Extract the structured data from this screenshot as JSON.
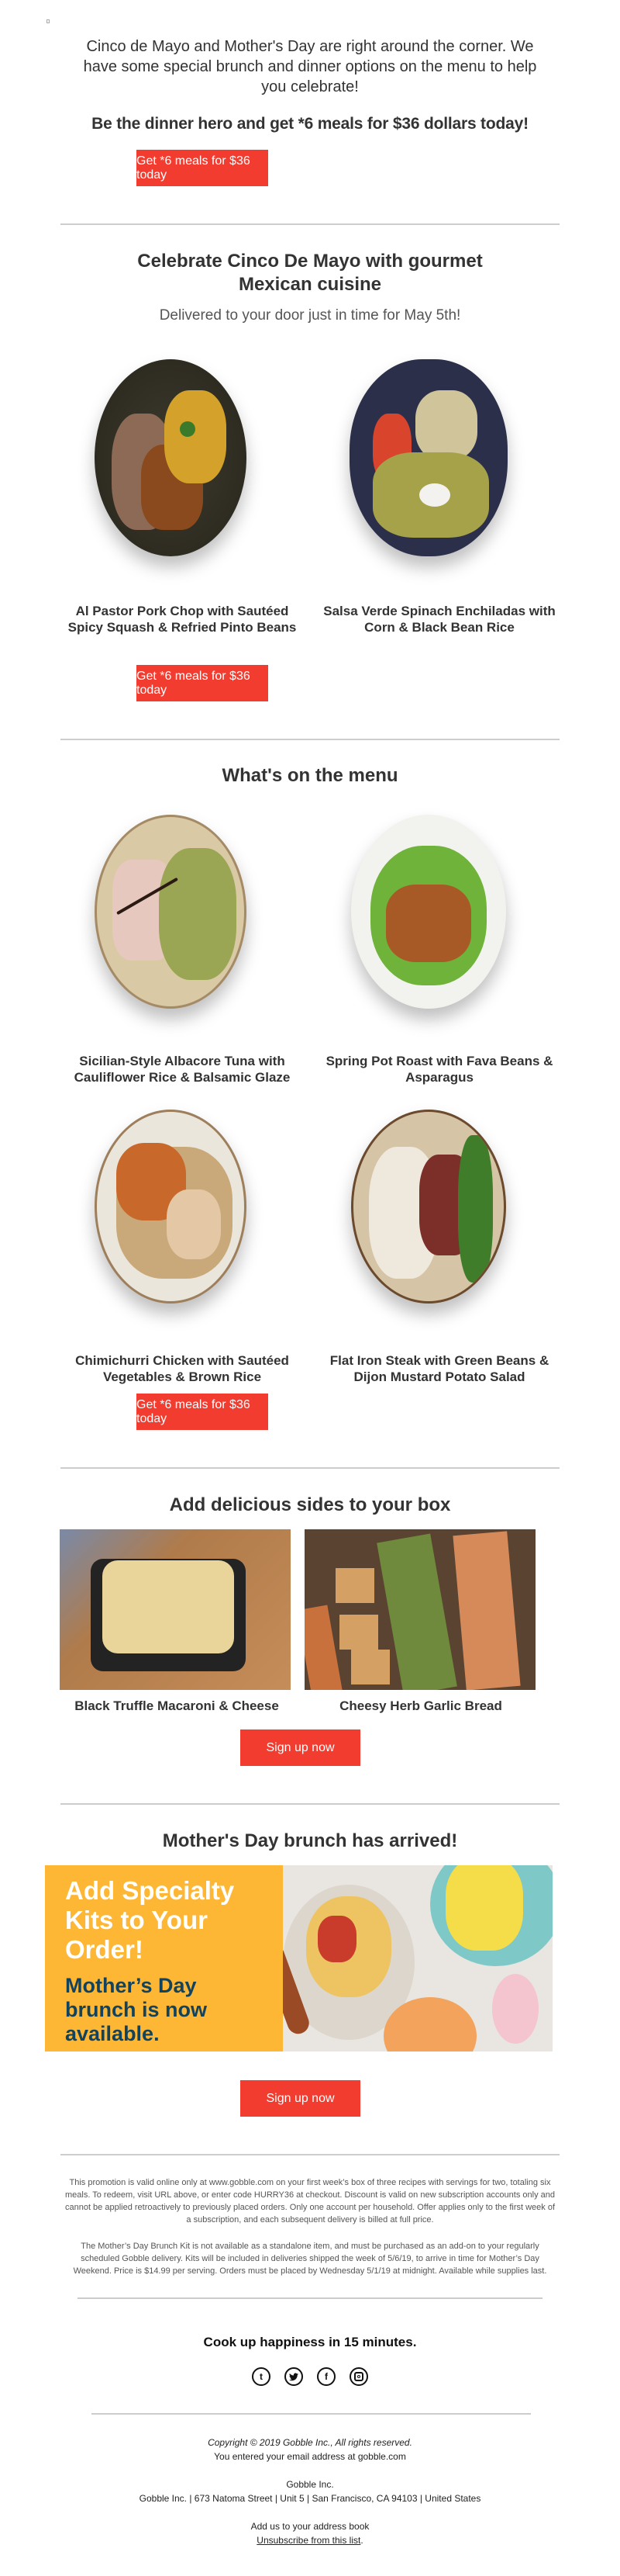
{
  "intro": {
    "text": "Cinco de Mayo and Mother's Day are right around the corner. We have some special brunch and dinner options on the menu to help you celebrate!",
    "headline": "Be the dinner hero and get *6 meals for $36 dollars today!",
    "cta_label": "Get *6 meals for $36 today"
  },
  "cinco": {
    "title": "Celebrate Cinco De Mayo with gourmet Mexican cuisine",
    "subtitle": "Delivered to your door just in time for May 5th!",
    "dishes": [
      {
        "name": "Al Pastor Pork Chop with Sautéed Spicy Squash & Refried Pinto Beans"
      },
      {
        "name": "Salsa Verde Spinach Enchiladas with Corn & Black Bean Rice"
      }
    ],
    "cta_label": "Get *6 meals for $36 today"
  },
  "menu": {
    "title": "What's on the menu",
    "dishes": [
      {
        "name": "Sicilian-Style Albacore Tuna with Cauliflower Rice & Balsamic Glaze"
      },
      {
        "name": "Spring Pot Roast with Fava Beans & Asparagus"
      },
      {
        "name": "Chimichurri Chicken with Sautéed Vegetables & Brown Rice"
      },
      {
        "name": "Flat Iron Steak with Green Beans & Dijon Mustard Potato Salad"
      }
    ],
    "cta_label": "Get *6 meals for $36 today"
  },
  "sides": {
    "title": "Add delicious sides to your box",
    "items": [
      {
        "name": "Black Truffle Macaroni & Cheese"
      },
      {
        "name": "Cheesy Herb Garlic Bread"
      }
    ],
    "cta_label": "Sign up now"
  },
  "brunch": {
    "title": "Mother's Day brunch has arrived!",
    "banner_heading": "Add Specialty Kits to Your Order!",
    "banner_subheading": "Mother’s Day brunch is now available.",
    "cta_label": "Sign up now"
  },
  "legal": {
    "promo_terms": "This promotion is valid online only at www.gobble.com on your first week’s box of three recipes with servings for two, totaling six meals. To redeem, visit URL above, or enter code HURRY36 at checkout. Discount is valid on new subscription accounts only and cannot be applied retroactively to previously placed orders. Only one account per household. Offer applies only to the first week of a subscription, and each subsequent delivery is billed at full price.",
    "brunch_terms": "The Mother’s Day Brunch Kit is not available as a standalone item, and must be purchased as an add-on to your regularly scheduled Gobble delivery. Kits will be included in deliveries shipped the week of 5/6/19, to arrive in time for Mother’s Day Weekend. Price is $14.99 per serving. Orders must be placed by Wednesday 5/1/19 at midnight. Available while supplies last."
  },
  "footer": {
    "tagline": "Cook up happiness in 15 minutes.",
    "socials": [
      {
        "icon": "tumblr-icon",
        "glyph": "t"
      },
      {
        "icon": "twitter-icon",
        "glyph": "🐦"
      },
      {
        "icon": "facebook-icon",
        "glyph": "f"
      },
      {
        "icon": "instagram-icon",
        "glyph": "◎"
      }
    ],
    "copyright": "Copyright © 2019 Gobble Inc., All rights reserved.",
    "email_note": "You entered your email address at gobble.com",
    "company": "Gobble Inc.",
    "address": "Gobble Inc. | 673 Natoma Street | Unit 5 | San Francisco, CA 94103 | United States",
    "address_book": "Add us to your address book",
    "unsubscribe": "Unsubscribe from this list",
    "unsubscribe_suffix": "."
  },
  "colors": {
    "cta": "#f23c30",
    "banner_yellow": "#fdb734",
    "banner_navy": "#13435c",
    "divider": "#cccccc"
  }
}
